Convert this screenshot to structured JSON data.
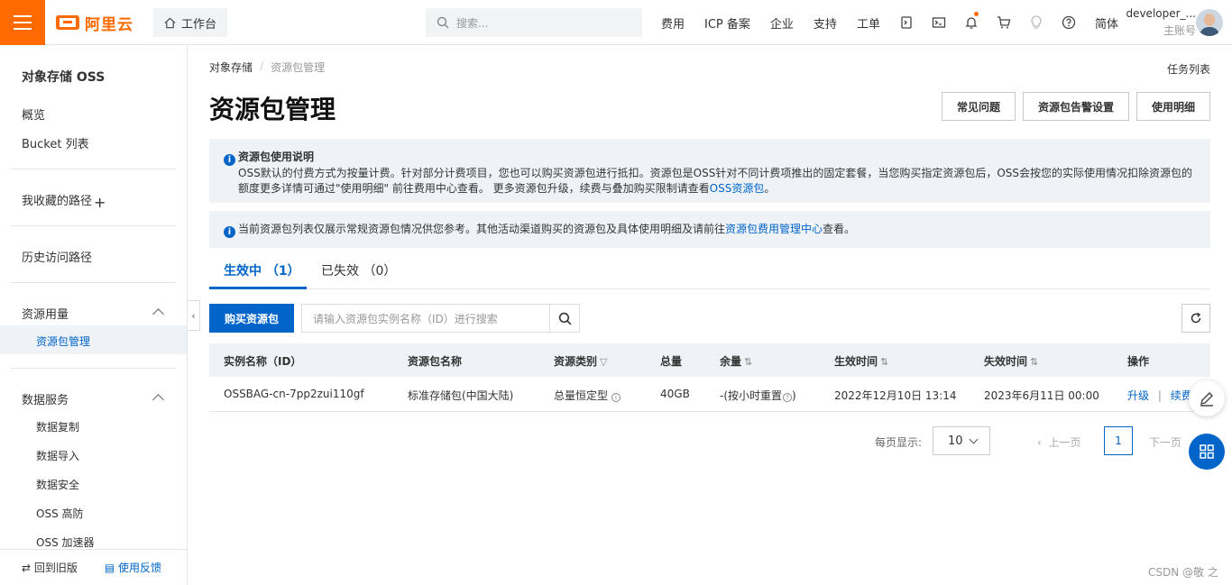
{
  "topbar": {
    "brand": "阿里云",
    "workbench": "工作台",
    "search_placeholder": "搜索...",
    "nav": [
      "费用",
      "ICP 备案",
      "企业",
      "支持",
      "工单"
    ],
    "lang": "简体",
    "user_name": "developer_...",
    "user_role": "主账号"
  },
  "sidebar": {
    "title": "对象存储 OSS",
    "items": {
      "overview": "概览",
      "bucket_list": "Bucket 列表",
      "favorites": "我收藏的路径",
      "history": "历史访问路径",
      "resource_usage": "资源用量",
      "resource_pkg": "资源包管理",
      "data_services": "数据服务",
      "data_copy": "数据复制",
      "data_import": "数据导入",
      "data_security": "数据安全",
      "oss_ddos": "OSS 高防",
      "oss_accel": "OSS 加速器"
    },
    "footer_back": "回到旧版",
    "footer_feedback": "使用反馈"
  },
  "breadcrumb": {
    "root": "对象存储",
    "current": "资源包管理"
  },
  "task_list": "任务列表",
  "page_title": "资源包管理",
  "header_buttons": {
    "faq": "常见问题",
    "alert": "资源包告警设置",
    "details": "使用明细"
  },
  "notice1": {
    "title": "资源包使用说明",
    "body": "OSS默认的付费方式为按量计费。针对部分计费项目，您也可以购买资源包进行抵扣。资源包是OSS针对不同计费项推出的固定套餐，当您购买指定资源包后，OSS会按您的实际使用情况扣除资源包的额度更多详情可通过\"使用明细\" 前往费用中心查看。 更多资源包升级，续费与叠加购买限制请查看",
    "link": "OSS资源包",
    "end": "。"
  },
  "notice2": {
    "body": "当前资源包列表仅展示常规资源包情况供您参考。其他活动渠道购买的资源包及具体使用明细及请前往",
    "link": "资源包费用管理中心",
    "end": "查看。"
  },
  "tabs": {
    "active": "生效中 （1）",
    "expired": "已失效 （0）"
  },
  "toolbar": {
    "buy": "购买资源包",
    "search_placeholder": "请输入资源包实例名称（ID）进行搜索"
  },
  "table": {
    "headers": [
      "实例名称（ID）",
      "资源包名称",
      "资源类别",
      "总量",
      "余量",
      "生效时间",
      "失效时间",
      "操作"
    ],
    "row": {
      "id": "OSSBAG-cn-7pp2zui110gf",
      "name": "标准存储包(中国大陆)",
      "type": "总量恒定型",
      "total": "40GB",
      "remain": "-(按小时重置",
      "remain_end": ")",
      "start": "2022年12月10日 13:14",
      "end": "2023年6月11日 00:00",
      "op_upgrade": "升级",
      "op_sep": "|",
      "op_renew": "续费"
    }
  },
  "pager": {
    "label": "每页显示:",
    "size": "10",
    "prev": "上一页",
    "current": "1",
    "next": "下一页"
  },
  "watermark": "CSDN @敬 之"
}
